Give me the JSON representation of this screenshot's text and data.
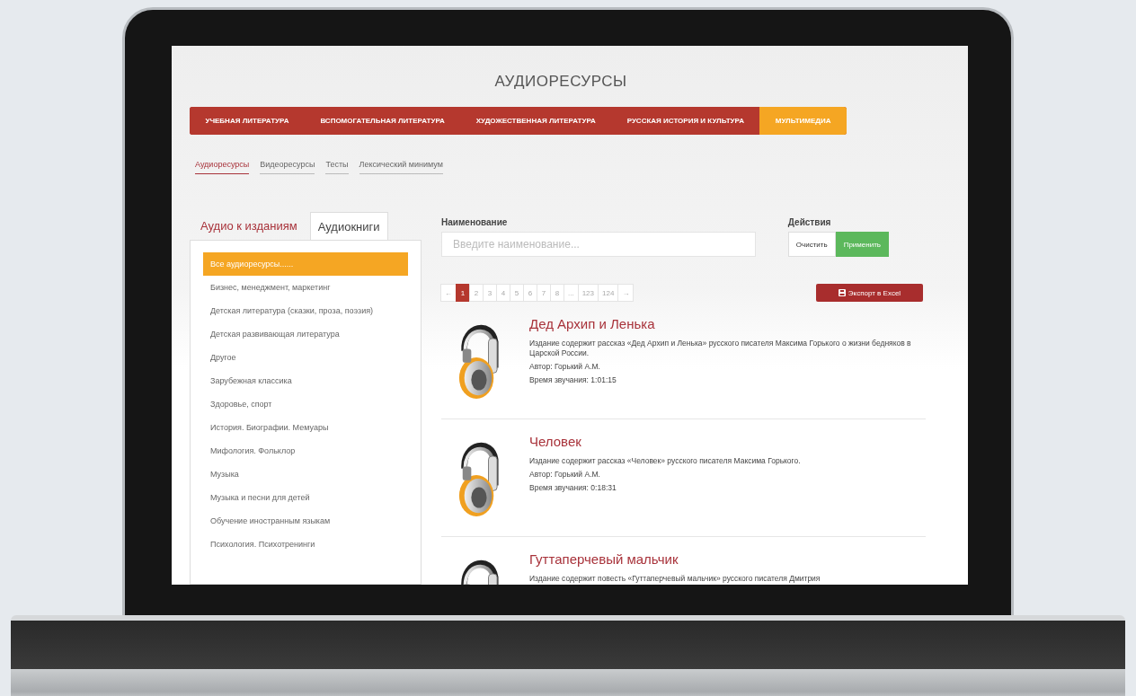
{
  "page_title": "АУДИОРЕСУРСЫ",
  "nav": [
    {
      "label": "УЧЕБНАЯ ЛИТЕРАТУРА",
      "selected": false
    },
    {
      "label": "ВСПОМОГАТЕЛЬНАЯ ЛИТЕРАТУРА",
      "selected": false
    },
    {
      "label": "ХУДОЖЕСТВЕННАЯ ЛИТЕРАТУРА",
      "selected": false
    },
    {
      "label": "РУССКАЯ ИСТОРИЯ И КУЛЬТУРА",
      "selected": false
    },
    {
      "label": "МУЛЬТИМЕДИА",
      "selected": true
    }
  ],
  "subtabs": [
    {
      "label": "Аудиоресурсы",
      "selected": true
    },
    {
      "label": "Видеоресурсы",
      "selected": false
    },
    {
      "label": "Тесты",
      "selected": false
    },
    {
      "label": "Лексический минимум",
      "selected": false
    }
  ],
  "sidebar": {
    "tabs": [
      {
        "label": "Аудио к изданиям",
        "selected": false
      },
      {
        "label": "Аудиокниги",
        "selected": true
      }
    ],
    "items": [
      {
        "label": "Все аудиоресурсы......",
        "selected": true
      },
      {
        "label": "Бизнес, менеджмент, маркетинг",
        "selected": false
      },
      {
        "label": "Детская литература (сказки, проза, поэзия)",
        "selected": false
      },
      {
        "label": "Детская развивающая литература",
        "selected": false
      },
      {
        "label": "Другое",
        "selected": false
      },
      {
        "label": "Зарубежная классика",
        "selected": false
      },
      {
        "label": "Здоровье, спорт",
        "selected": false
      },
      {
        "label": "История. Биографии. Мемуары",
        "selected": false
      },
      {
        "label": "Мифология. Фольклор",
        "selected": false
      },
      {
        "label": "Музыка",
        "selected": false
      },
      {
        "label": "Музыка и песни для детей",
        "selected": false
      },
      {
        "label": "Обучение иностранным языкам",
        "selected": false
      },
      {
        "label": "Психология. Психотренинги",
        "selected": false
      }
    ]
  },
  "filter": {
    "name_label": "Наименование",
    "placeholder": "Введите наименование...",
    "actions_label": "Действия",
    "buttons": [
      {
        "label": "Очистить",
        "kind": "default"
      },
      {
        "label": "Применить",
        "kind": "primary"
      }
    ]
  },
  "pagination": [
    {
      "label": "←",
      "selected": false
    },
    {
      "label": "1",
      "selected": true
    },
    {
      "label": "2",
      "selected": false
    },
    {
      "label": "3",
      "selected": false
    },
    {
      "label": "4",
      "selected": false
    },
    {
      "label": "5",
      "selected": false
    },
    {
      "label": "6",
      "selected": false
    },
    {
      "label": "7",
      "selected": false
    },
    {
      "label": "8",
      "selected": false
    },
    {
      "label": "...",
      "selected": false
    },
    {
      "label": "123",
      "selected": false
    },
    {
      "label": "124",
      "selected": false
    },
    {
      "label": "→",
      "selected": false
    }
  ],
  "export_button": "Экспорт в Excel",
  "items": [
    {
      "title": "Дед Архип и Ленька",
      "description": "Издание содержит рассказ «Дед Архип и Ленька» русского писателя Максима Горького о жизни бедняков в Царской России.",
      "author": "Автор: Горький А.М.",
      "duration": "Время звучания: 1:01:15"
    },
    {
      "title": "Человек",
      "description": "Издание содержит рассказ «Человек» русского писателя Максима Горького.",
      "author": "Автор: Горький А.М.",
      "duration": "Время звучания: 0:18:31"
    },
    {
      "title": "Гуттаперчевый мальчик",
      "description": "Издание содержит повесть «Гуттаперчевый мальчик» русского писателя Дмитрия"
    }
  ]
}
